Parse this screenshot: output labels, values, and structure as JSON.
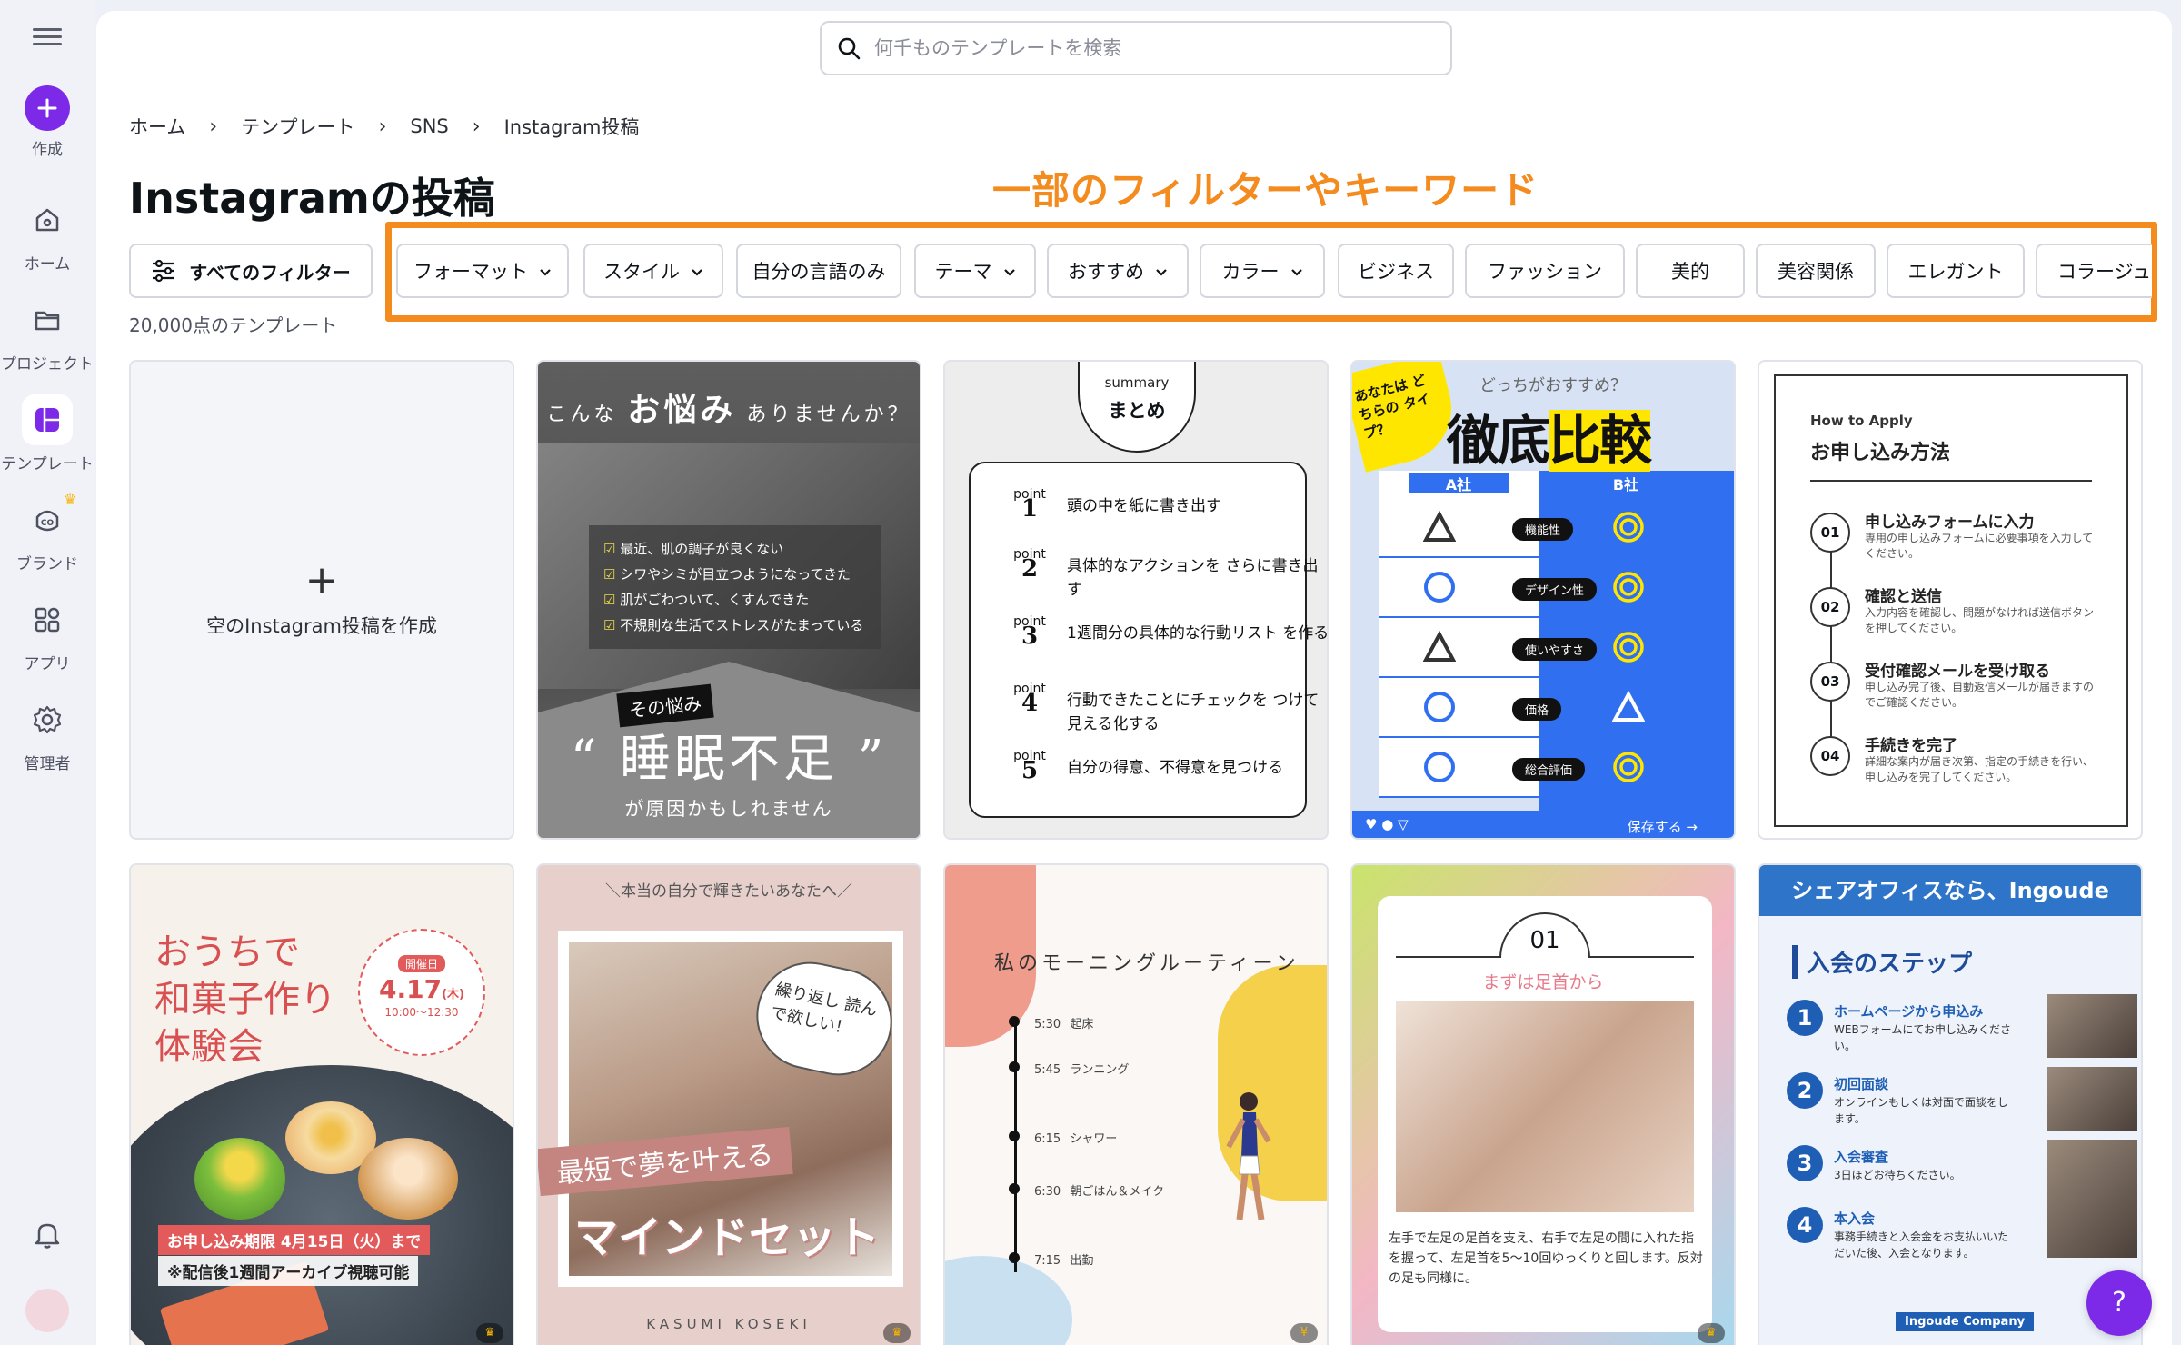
{
  "sidebar": {
    "items": [
      {
        "label": "作成"
      },
      {
        "label": "ホーム"
      },
      {
        "label": "プロジェクト"
      },
      {
        "label": "テンプレート"
      },
      {
        "label": "ブランド"
      },
      {
        "label": "アプリ"
      },
      {
        "label": "管理者"
      }
    ]
  },
  "search": {
    "placeholder": "何千ものテンプレートを検索"
  },
  "breadcrumb": [
    "ホーム",
    "テンプレート",
    "SNS",
    "Instagram投稿"
  ],
  "page_title": "Instagramの投稿",
  "annotation": "一部のフィルターやキーワード",
  "filters": {
    "all_label": "すべてのフィルター",
    "chips": [
      "フォーマット",
      "スタイル",
      "自分の言語のみ",
      "テーマ",
      "おすすめ",
      "カラー",
      "ビジネス",
      "ファッション",
      "美的",
      "美容関係",
      "エレガント",
      "コラージュ"
    ]
  },
  "count": "20,000点のテンプレート",
  "empty_card": {
    "plus": "+",
    "label": "空のInstagram投稿を作成"
  },
  "templates": {
    "sleep": {
      "question_a": "こんな",
      "question_b": "お悩み",
      "question_c": "ありませんか？",
      "list": [
        "最近、肌の調子が良くない",
        "シワやシミが目立つようになってきた",
        "肌がごわついて、くすんできた",
        "不規則な生活でストレスがたまっている"
      ],
      "tag": "その悩み",
      "big": "“ 睡眠不足 ”",
      "sub": "が原因かもしれません"
    },
    "summary": {
      "head_small": "summary",
      "head_main": "まとめ",
      "point_word": "point",
      "points": [
        {
          "n": "1",
          "text": "頭の中を紙に書き出す"
        },
        {
          "n": "2",
          "text": "具体的なアクションを さらに書き出す"
        },
        {
          "n": "3",
          "text": "1週間分の具体的な行動リスト を作る"
        },
        {
          "n": "4",
          "text": "行動できたことにチェックを つけて見える化する"
        },
        {
          "n": "5",
          "text": "自分の得意、不得意を見つける"
        }
      ]
    },
    "compare": {
      "sticker": "あなたは どちらの タイプ？",
      "which": "どっちがおすすめ？",
      "title_a": "徹底",
      "title_b": "比較",
      "col_a": "A社",
      "col_b": "B社",
      "rows": [
        "機能性",
        "デザイン性",
        "使いやすさ",
        "価格",
        "総合評価"
      ],
      "save": "保存する →"
    },
    "apply": {
      "en": "How to Apply",
      "title": "お申し込み方法",
      "steps": [
        {
          "n": "01",
          "title": "申し込みフォームに入力",
          "desc": "専用の申し込みフォームに必要事項を入力してください。"
        },
        {
          "n": "02",
          "title": "確認と送信",
          "desc": "入力内容を確認し、問題がなければ送信ボタンを押してください。"
        },
        {
          "n": "03",
          "title": "受付確認メールを受け取る",
          "desc": "申し込み完了後、自動返信メールが届きますのでご確認ください。"
        },
        {
          "n": "04",
          "title": "手続きを完了",
          "desc": "詳細な案内が届き次第、指定の手続きを行い、申し込みを完了してください。"
        }
      ]
    },
    "wagashi": {
      "title": "おうちで\n和菓子作り\n体験会",
      "badge_k": "開催日",
      "badge_d": "4.17",
      "badge_dow": "(木)",
      "badge_t": "10:00〜12:30",
      "bar1": "お申し込み期限 4月15日（火）まで",
      "bar2": "※配信後1週間アーカイブ視聴可能"
    },
    "dream": {
      "top": "＼本当の自分で輝きたいあなたへ／",
      "bubble": "繰り返し 読んで欲しい！",
      "b1": "最短で夢を叶える",
      "b2": "マインドセット",
      "name": "KASUMI KOSEKI"
    },
    "morning": {
      "title": "私のモーニングルーティーン",
      "events": [
        {
          "t": "5:30",
          "e": "起床"
        },
        {
          "t": "5:45",
          "e": "ランニング"
        },
        {
          "t": "6:15",
          "e": "シャワー"
        },
        {
          "t": "6:30",
          "e": "朝ごはん＆メイク"
        },
        {
          "t": "7:15",
          "e": "出勤"
        }
      ],
      "badge": "¥"
    },
    "foot": {
      "num": "01",
      "sub": "まずは足首から",
      "desc": "左手で左足の足首を支え、右手で左足の間に入れた指を握って、左足首を5〜10回ゆっくりと回します。反対の足も同様に。"
    },
    "office": {
      "top": "シェアオフィスなら、Ingoude",
      "heading": "入会のステップ",
      "steps": [
        {
          "n": "1",
          "title": "ホームページから申込み",
          "desc": "WEBフォームにてお申し込みください。"
        },
        {
          "n": "2",
          "title": "初回面談",
          "desc": "オンラインもしくは対面で面談をします。"
        },
        {
          "n": "3",
          "title": "入会審査",
          "desc": "3日ほどお待ちください。"
        },
        {
          "n": "4",
          "title": "本入会",
          "desc": "事務手続きと入会金をお支払いいただいた後、入会となります。"
        }
      ],
      "company": "Ingoude Company"
    }
  },
  "help": "?",
  "colors": {
    "accent": "#7d2ae8",
    "annotation": "#f48b1f"
  }
}
